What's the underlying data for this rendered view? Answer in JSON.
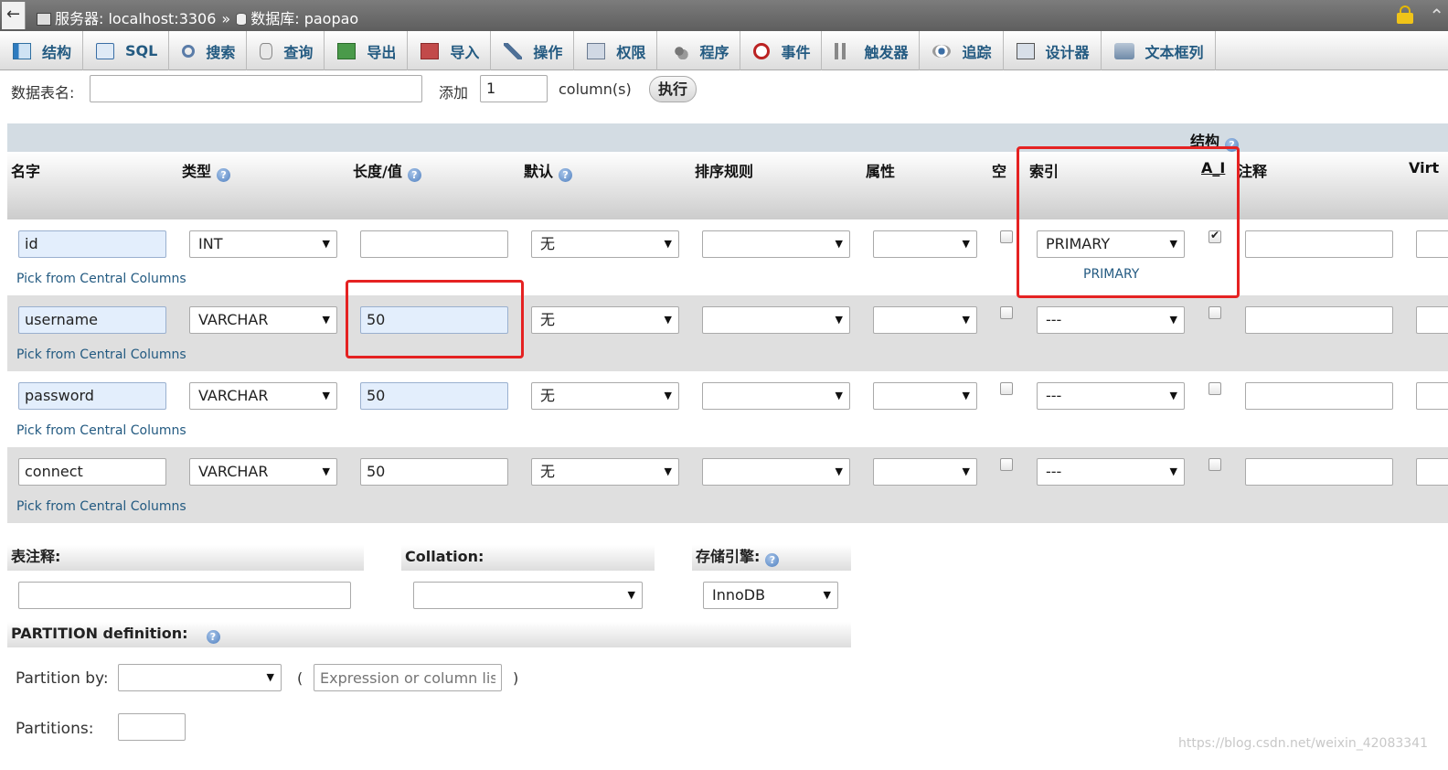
{
  "breadcrumb": {
    "back": "←",
    "server": "服务器: localhost:3306",
    "separator": "»",
    "database": "数据库: paopao"
  },
  "tabs": [
    {
      "label": "结构",
      "icon": "structure-icon"
    },
    {
      "label": "SQL",
      "icon": "sql-icon"
    },
    {
      "label": "搜索",
      "icon": "search-icon"
    },
    {
      "label": "查询",
      "icon": "query-icon"
    },
    {
      "label": "导出",
      "icon": "export-icon"
    },
    {
      "label": "导入",
      "icon": "import-icon"
    },
    {
      "label": "操作",
      "icon": "wrench-icon"
    },
    {
      "label": "权限",
      "icon": "privileges-icon"
    },
    {
      "label": "程序",
      "icon": "routines-icon"
    },
    {
      "label": "事件",
      "icon": "clock-icon"
    },
    {
      "label": "触发器",
      "icon": "triggers-icon"
    },
    {
      "label": "追踪",
      "icon": "eye-icon"
    },
    {
      "label": "设计器",
      "icon": "designer-icon"
    },
    {
      "label": "文本框列",
      "icon": "textfield-icon"
    }
  ],
  "add_row": {
    "table_name_label": "数据表名:",
    "table_name_value": "",
    "add_label": "添加",
    "add_count": "1",
    "columns_label": "column(s)",
    "exec_label": "执行"
  },
  "header": {
    "group_structure": "结构",
    "name": "名字",
    "type": "类型",
    "length": "长度/值",
    "default": "默认",
    "collation": "排序规则",
    "attributes": "属性",
    "null": "空",
    "index": "索引",
    "ai": "A_I",
    "comment": "注释",
    "virtuality": "Virt"
  },
  "pick_central": "Pick from Central Columns",
  "rows": [
    {
      "name": "id",
      "type": "INT",
      "length": "",
      "default": "无",
      "collation": "",
      "attribute": "",
      "null": false,
      "index": "PRIMARY",
      "index_note": "PRIMARY",
      "ai": true,
      "comment": ""
    },
    {
      "name": "username",
      "type": "VARCHAR",
      "length": "50",
      "default": "无",
      "collation": "",
      "attribute": "",
      "null": false,
      "index": "---",
      "index_note": "",
      "ai": false,
      "comment": ""
    },
    {
      "name": "password",
      "type": "VARCHAR",
      "length": "50",
      "default": "无",
      "collation": "",
      "attribute": "",
      "null": false,
      "index": "---",
      "index_note": "",
      "ai": false,
      "comment": ""
    },
    {
      "name": "connect",
      "type": "VARCHAR",
      "length": "50",
      "default": "无",
      "collation": "",
      "attribute": "",
      "null": false,
      "index": "---",
      "index_note": "",
      "ai": false,
      "comment": ""
    }
  ],
  "bottom": {
    "table_comment_label": "表注释:",
    "table_comment_value": "",
    "collation_label": "Collation:",
    "collation_value": "",
    "engine_label": "存储引擎:",
    "engine_value": "InnoDB",
    "partition_label": "PARTITION definition:",
    "partition_by_label": "Partition by:",
    "partition_by_value": "",
    "open_paren": "(",
    "expression_placeholder": "Expression or column list",
    "close_paren": ")",
    "partitions_label": "Partitions:",
    "partitions_value": ""
  },
  "watermark": "https://blog.csdn.net/weixin_42083341",
  "colors": {
    "highlight_box": "#e52222",
    "link": "#235a81",
    "input_highlight": "#e3eefc"
  }
}
